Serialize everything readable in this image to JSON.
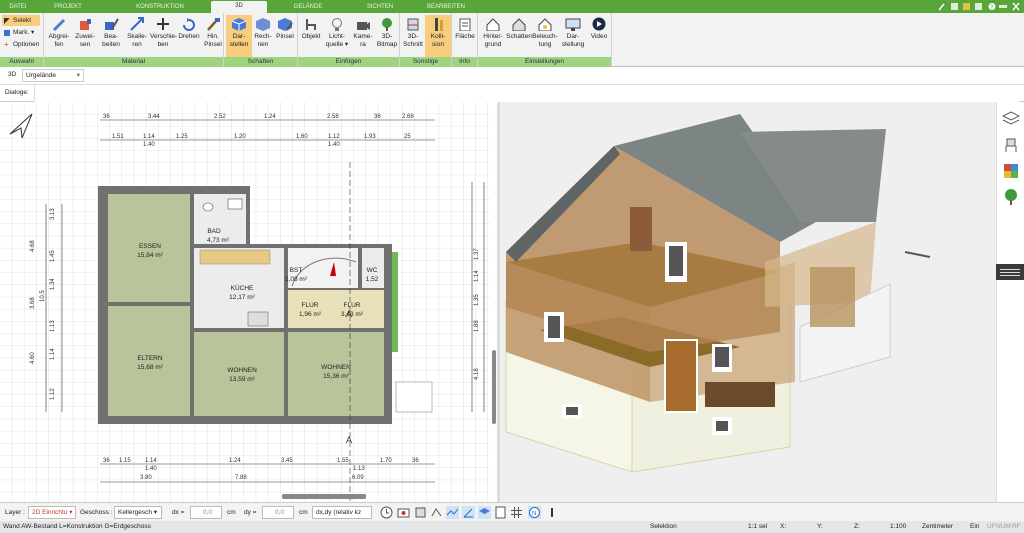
{
  "tabs": [
    "DATEI",
    "PROJEKT",
    "KONSTRUKTION",
    "3D",
    "GELÄNDE",
    "SICHTEN",
    "BEARBEITEN"
  ],
  "selection": {
    "selekt": "Selekt",
    "mark": "Mark.",
    "optionen": "Optionen"
  },
  "ribbon": {
    "buttons": {
      "abgreifen": "Abgrei-\nfen",
      "zuweisen": "Zuwei-\nsen",
      "bearbeiten": "Bea-\nbeiten",
      "skalieren": "Skalie-\nren",
      "verschieben": "Verschie-\nben",
      "drehen": "Drehen",
      "hinpinsel": "Hin.\nPinsel",
      "darstellen": "Dar-\nstellen",
      "rechnen": "Rech-\nnen",
      "pinsel": "Pinsel",
      "objekt": "Objekt",
      "lichtquelle": "Licht-\nquelle ▾",
      "kamera": "Kame-\nra",
      "bitmap": "3D-\nBitmap",
      "schnitt": "3D-\nSchnitt",
      "kollision": "Kolli-\nsion",
      "flaeche": "Fläche",
      "hintergrund": "Hinter-\ngrund",
      "schatten": "Schatten",
      "beleuchtung": "Beleuch-\ntung",
      "darstellung": "Dar-\nstellung",
      "video": "Video"
    },
    "groups": {
      "auswahl": "Auswahl",
      "material": "Material",
      "schatten": "Schatten",
      "einfuegen": "Einfügen",
      "sonstige": "Sonstige",
      "info": "Info",
      "einstellungen": "Einstellungen"
    }
  },
  "bar3d": {
    "label": "3D",
    "combo": "Urgelände"
  },
  "dialog": {
    "label": "Dialoge:"
  },
  "plan": {
    "rooms": [
      {
        "name": "ESSEN",
        "area": "15,84 m²"
      },
      {
        "name": "BAD",
        "area": "4,73 m²"
      },
      {
        "name": "KÜCHE",
        "area": "12,17 m²"
      },
      {
        "name": "FLUR",
        "area": "1,96 m²"
      },
      {
        "name": "FLUR",
        "area": "3,43 m²"
      },
      {
        "name": "ELTERN",
        "area": "15,68 m²"
      },
      {
        "name": "WOHNEN",
        "area": "13,59 m²"
      },
      {
        "name": "WOHNEN",
        "area": "15,36 m²"
      },
      {
        "name": "BST",
        "area": "1,08 m²"
      },
      {
        "name": "WC",
        "area": "1,52"
      }
    ],
    "dims_top1": [
      "36",
      "3.44",
      "2.52",
      "1.24",
      "2.58",
      "36",
      "2.68"
    ],
    "dims_top2": [
      "1.51",
      "1.14",
      "1.40",
      "1.25",
      "1.20",
      "1.60",
      "1.12",
      "1.40",
      "1.93",
      "25"
    ],
    "dims_bottom1": [
      "36",
      "1.15",
      "1.14",
      "1.40",
      "1.24",
      "3.45",
      "1.55",
      "1.13",
      "1.70",
      "36"
    ],
    "dims_bottom2": [
      "3.80",
      "7.88",
      "6.09"
    ],
    "dims_left": [
      "10.5",
      "4.68",
      "3.68",
      "4.60",
      "3.13",
      "1.45",
      "1.34",
      "1.13",
      "1.14",
      "1.12"
    ],
    "dims_right": [
      "1.37",
      "1.14",
      "1.35",
      "1.88",
      "4.18"
    ],
    "section": "A"
  },
  "toolbar": {
    "layer_label": "Layer :",
    "layer_value": "2D Einrichtu",
    "geschoss_label": "Geschoss :",
    "geschoss_value": "Kellergesch",
    "dx_label": "dx =",
    "dx_value": "0,0",
    "unit1": "cm",
    "dy_label": "dy =",
    "dy_value": "0,0",
    "unit2": "cm",
    "mode": "dx,dy (relativ kz"
  },
  "status": {
    "left": "Wand AW-Bestand L=Konstruktion G=Erdgeschoss",
    "selektion": "Selektion",
    "scale": "1:1 sel",
    "x": "X:",
    "y": "Y:",
    "z": "Z:",
    "zoom": "1:100",
    "units": "Zentimeter",
    "ein": "Ein",
    "uf": "UF",
    "num": "NUM",
    "rf": "RF"
  },
  "colors": {
    "ribbon_green": "#58a53a",
    "group_label": "#9fd481",
    "highlight": "#f9cd7e",
    "floor": "#b9c49a",
    "walls": "#666666"
  }
}
